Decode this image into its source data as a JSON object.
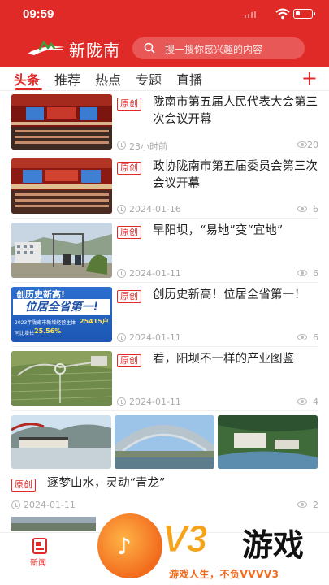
{
  "status_bar": {
    "time": "09:59"
  },
  "header": {
    "brand": "新陇南",
    "search_placeholder": "搜一搜你感兴趣的内容"
  },
  "tabs": [
    {
      "label": "头条",
      "active": true
    },
    {
      "label": "推荐",
      "active": false
    },
    {
      "label": "热点",
      "active": false
    },
    {
      "label": "专题",
      "active": false
    },
    {
      "label": "直播",
      "active": false
    }
  ],
  "add_icon": "plus-icon",
  "articles": [
    {
      "badge": "原创",
      "title": "陇南市第五届人民代表大会第三次会议开幕",
      "date": "23小时前",
      "views": "20"
    },
    {
      "badge": "原创",
      "title": "政协陇南市第五届委员会第三次会议开幕",
      "date": "2024-01-16",
      "views": "6"
    },
    {
      "badge": "原创",
      "title": "早阳坝，“易地”变“宜地”",
      "date": "2024-01-11",
      "views": "6"
    },
    {
      "badge": "原创",
      "title": "创历史新高！位居全省第一！",
      "date": "2024-01-11",
      "views": "6",
      "thumb_text": {
        "line1": "创历史新高!",
        "line2": "位居全省第一!",
        "caption": "2023年陇南市新增经营主体",
        "number": "25415户",
        "growth_label": "同比增长",
        "growth": "25.56%"
      }
    },
    {
      "badge": "原创",
      "title": "看，阳坝不一样的产业图鉴",
      "date": "2024-01-11",
      "views": "4"
    },
    {
      "badge": "原创",
      "title": "逐梦山水，灵动“青龙”",
      "date": "2024-01-11",
      "views": "2"
    }
  ],
  "bottom_nav": [
    {
      "label": "新闻",
      "active": true
    }
  ],
  "watermark": {
    "brand": "V3",
    "name": "游戏",
    "slogan": "游戏人生，不负VVVV3"
  },
  "colors": {
    "accent": "#e02a28",
    "watermark_orange": "#f26b1d"
  }
}
